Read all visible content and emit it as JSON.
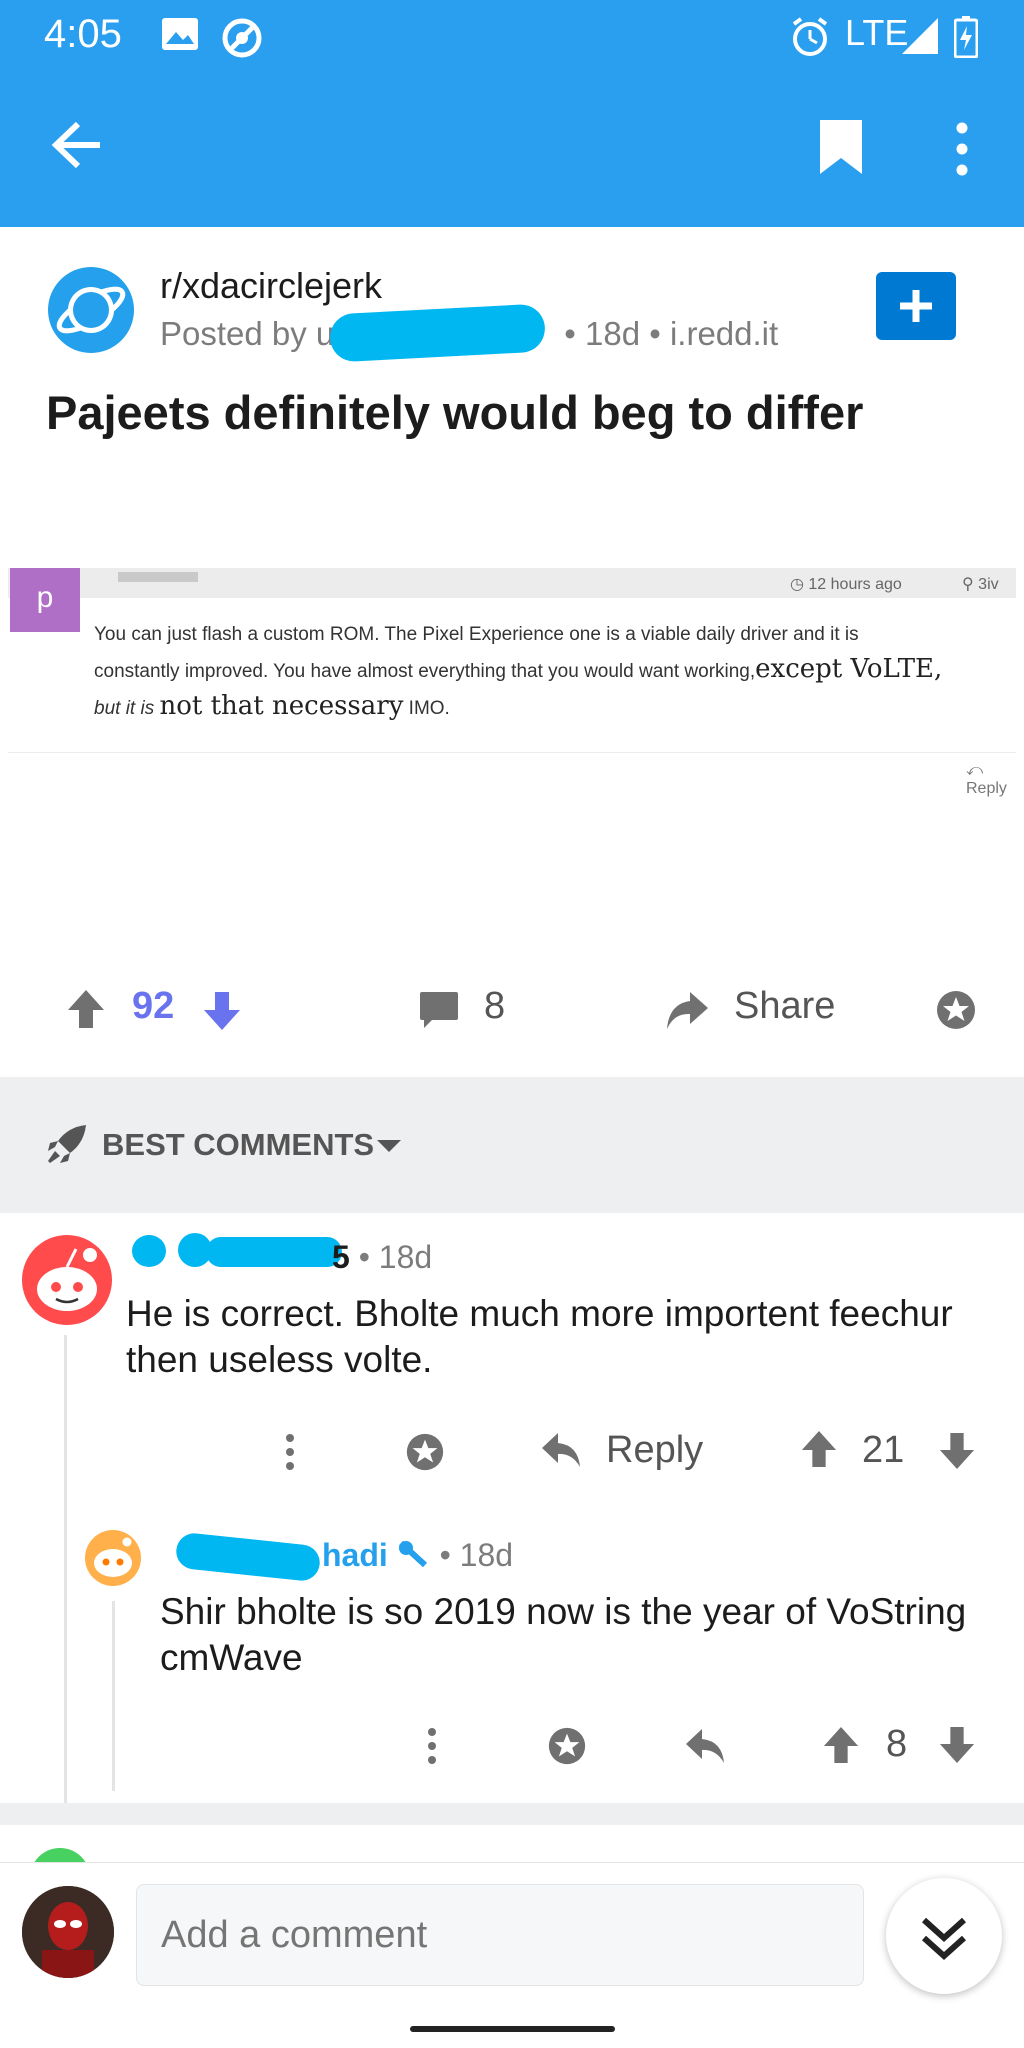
{
  "status_bar": {
    "time": "4:05",
    "network": "LTE"
  },
  "post": {
    "subreddit": "r/xdacirclejerk",
    "posted_by_prefix": "Posted by u",
    "meta_suffix": "• 18d • i.redd.it",
    "title": "Pajeets definitely would beg to differ"
  },
  "embedded_image": {
    "avatar_letter": "p",
    "time_ago": "12 hours ago",
    "location": "3iv",
    "text_line1": "You can just flash a custom ROM. The Pixel Experience one is a viable daily driver and it is",
    "text_line2": "constantly improved. You have almost everything that you would want working,",
    "text_line2_big": "except VoLTE,",
    "text_line3_prefix": "but it is",
    "text_line3_big": "not that necessary",
    "text_line3_suffix": "IMO.",
    "reply_label": "Reply"
  },
  "actions": {
    "score": "92",
    "comments": "8",
    "share": "Share"
  },
  "sort": {
    "label": "BEST COMMENTS"
  },
  "comments": [
    {
      "author_visible_end": "5",
      "age": "• 18d",
      "body": "He is correct. Bholte much more importent feechur then useless volte.",
      "reply_label": "Reply",
      "score": "21"
    },
    {
      "author_visible": "hadi",
      "age": "• 18d",
      "body": "Shir bholte is so 2019 now is the year of VoString cmWave",
      "score": "8"
    }
  ],
  "composer": {
    "placeholder": "Add a comment"
  },
  "colors": {
    "app_bar": "#2a9ff0",
    "brand_blue": "#0079d3",
    "upvote_score": "#6a73ee",
    "scribble": "#00b7f1"
  }
}
